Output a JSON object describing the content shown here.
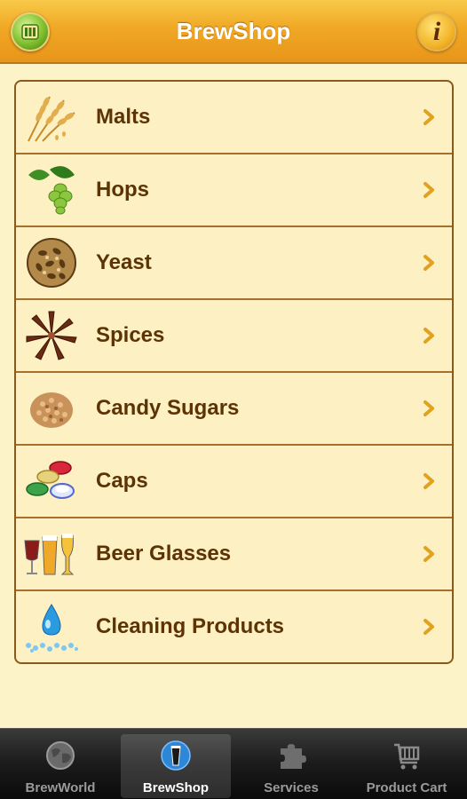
{
  "header": {
    "title": "BrewShop",
    "logo_icon": "brewworld-logo-icon",
    "info_icon": "info-icon",
    "info_glyph": "i"
  },
  "categories": [
    {
      "label": "Malts",
      "icon": "wheat-icon"
    },
    {
      "label": "Hops",
      "icon": "hops-icon"
    },
    {
      "label": "Yeast",
      "icon": "yeast-icon"
    },
    {
      "label": "Spices",
      "icon": "star-anise-icon"
    },
    {
      "label": "Candy Sugars",
      "icon": "sugar-icon"
    },
    {
      "label": "Caps",
      "icon": "bottle-caps-icon"
    },
    {
      "label": "Beer Glasses",
      "icon": "beer-glasses-icon"
    },
    {
      "label": "Cleaning Products",
      "icon": "water-drop-icon"
    }
  ],
  "tabbar": {
    "tabs": [
      {
        "label": "BrewWorld",
        "icon": "globe-icon",
        "active": false
      },
      {
        "label": "BrewShop",
        "icon": "glass-icon",
        "active": true
      },
      {
        "label": "Services",
        "icon": "puzzle-icon",
        "active": false
      },
      {
        "label": "Product Cart",
        "icon": "cart-icon",
        "active": false
      }
    ]
  },
  "colors": {
    "header_top": "#f8c94a",
    "header_bottom": "#e8951a",
    "background": "#fdf3c9",
    "row_text": "#5c3305",
    "chevron": "#e0a21f",
    "border": "#8a5a1c",
    "tabbar": "#1b1b1b",
    "tab_active_text": "#ffffff",
    "tab_inactive_text": "#9a9a9a"
  }
}
